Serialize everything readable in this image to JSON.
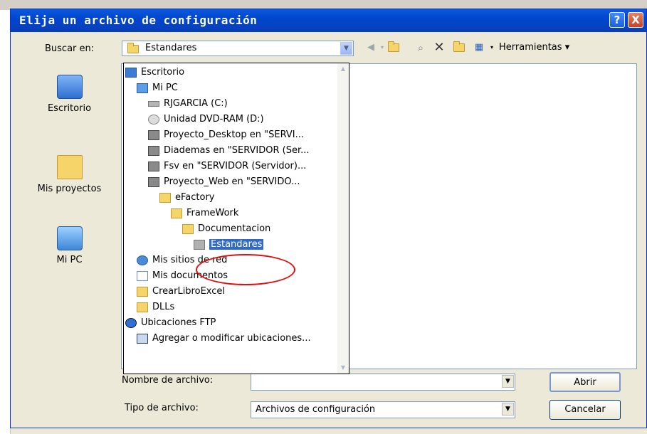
{
  "window": {
    "title": "Elija un archivo de configuración",
    "help_glyph": "?",
    "close_glyph": "X"
  },
  "lookin": {
    "label": "Buscar en:",
    "value": "Estandares"
  },
  "toolbar": {
    "tools_label": "Herramientas"
  },
  "places": [
    {
      "label": "Escritorio",
      "icon": "desktop-icon"
    },
    {
      "label": "Mis proyectos",
      "icon": "folder-icon"
    },
    {
      "label": "Mi PC",
      "icon": "computer-icon"
    }
  ],
  "dropdown": {
    "items": [
      {
        "label": "Escritorio",
        "icon": "desktop-icon"
      },
      {
        "label": "Mi PC",
        "icon": "computer-icon"
      },
      {
        "label": "RJGARCIA (C:)",
        "icon": "drive-icon"
      },
      {
        "label": "Unidad DVD-RAM (D:)",
        "icon": "dvd-icon"
      },
      {
        "label": "Proyecto_Desktop en \"SERVI...",
        "icon": "network-drive-icon"
      },
      {
        "label": "Diademas en \"SERVIDOR (Ser...",
        "icon": "network-drive-icon"
      },
      {
        "label": "Fsv en \"SERVIDOR (Servidor)...",
        "icon": "network-drive-icon"
      },
      {
        "label": "Proyecto_Web en \"SERVIDO...",
        "icon": "network-drive-icon"
      },
      {
        "label": "eFactory",
        "icon": "folder-icon"
      },
      {
        "label": "FrameWork",
        "icon": "folder-icon"
      },
      {
        "label": "Documentacion",
        "icon": "folder-icon"
      },
      {
        "label": "Estandares",
        "icon": "folder-icon",
        "selected": true
      },
      {
        "label": "Mis sitios de red",
        "icon": "network-places-icon"
      },
      {
        "label": "Mis documentos",
        "icon": "documents-icon"
      },
      {
        "label": "CrearLibroExcel",
        "icon": "folder-icon"
      },
      {
        "label": "DLLs",
        "icon": "folder-icon"
      },
      {
        "label": "Ubicaciones FTP",
        "icon": "ftp-icon"
      },
      {
        "label": "Agregar o modificar ubicaciones...",
        "icon": "ftp-add-icon"
      }
    ]
  },
  "filename": {
    "label": "Nombre de archivo:",
    "value": ""
  },
  "filetype": {
    "label": "Tipo de archivo:",
    "value": "Archivos de configuración"
  },
  "buttons": {
    "open": "Abrir",
    "cancel": "Cancelar"
  }
}
